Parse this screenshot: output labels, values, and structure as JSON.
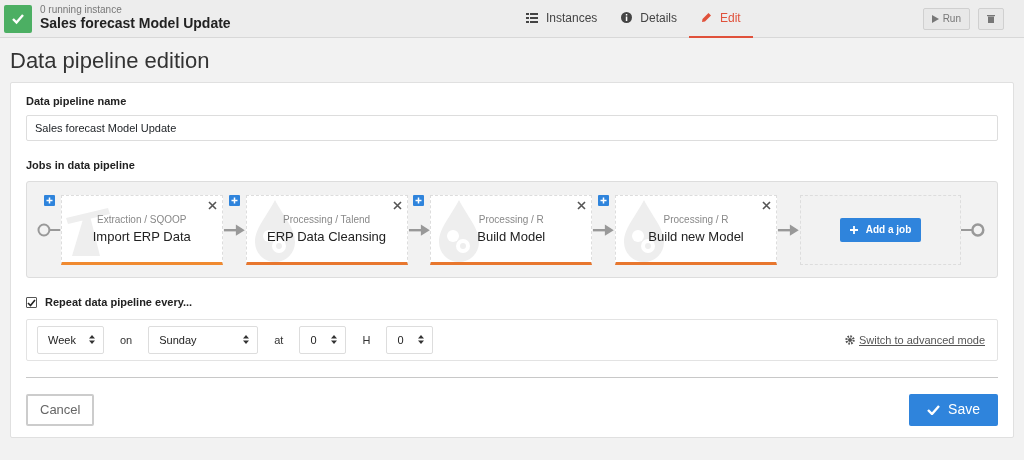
{
  "header": {
    "ok": true,
    "status": "0 running instance",
    "title": "Sales forecast Model Update"
  },
  "tabs": [
    {
      "kind": "list",
      "label": "Instances",
      "selected": false
    },
    {
      "kind": "info",
      "label": "Details",
      "selected": false
    },
    {
      "kind": "edit",
      "label": "Edit",
      "selected": true
    }
  ],
  "actions": [
    {
      "kind": "run",
      "label": "Run",
      "disabled": true
    },
    {
      "kind": "delete",
      "disabled": true
    }
  ],
  "page_title": "Data pipeline edition",
  "form": {
    "name_label": "Data pipeline name",
    "name_value": "Sales forecast Model Update",
    "jobs_label": "Jobs in data pipeline",
    "jobs": [
      {
        "kind": "extraction",
        "category": "Extraction / SQOOP",
        "name": "Import ERP Data"
      },
      {
        "kind": "processing",
        "category": "Processing / Talend",
        "name": "ERP Data Cleansing"
      },
      {
        "kind": "processing",
        "category": "Processing / R",
        "name": "Build Model"
      },
      {
        "kind": "processing",
        "category": "Processing / R",
        "name": "Build new Model"
      }
    ],
    "add_job": "Add a job",
    "repeat": {
      "label": "Repeat data pipeline every...",
      "checked": true,
      "period": "Week",
      "on_label": "on",
      "day": "Sunday",
      "at_label": "at",
      "hour": "0",
      "h_label": "H",
      "minute": "0",
      "advanced_link": "Switch to advanced mode"
    }
  },
  "buttons": {
    "cancel": "Cancel",
    "save": "Save"
  }
}
